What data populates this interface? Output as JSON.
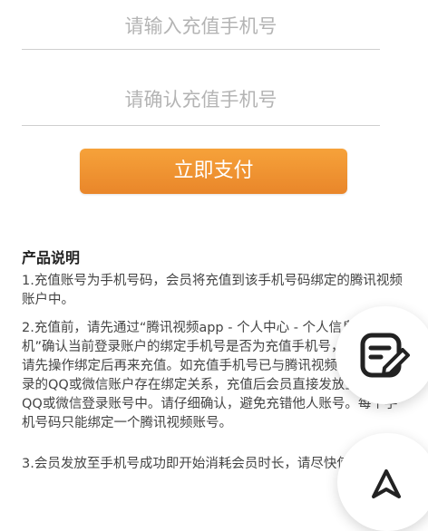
{
  "form": {
    "phone_placeholder": "请输入充值手机号",
    "confirm_placeholder": "请确认充值手机号",
    "pay_button": "立即支付"
  },
  "product": {
    "title": "产品说明",
    "paragraphs": [
      "1.充值账号为手机号码，会员将充值到该手机号码绑定的腾讯视频账户中。",
      "2.充值前，请先通过“腾讯视频app - 个人中心 - 个人信息 - 手机”确认当前登录账户的绑定手机号是否为充值手机号，若未绑定的请先操作绑定后再来充值。如充值手机号已与腾讯视频app中与登录的QQ或微信账户存在绑定关系，充值后会员直接发放至绑定的QQ或微信登录账号中。请仔细确认，避免充错他人账号。每个手机号码只能绑定一个腾讯视频账号。",
      "3.会员发放至手机号成功即开始消耗会员时长，请尽快使用。"
    ]
  },
  "floating": {
    "edit_icon": "edit-note-icon",
    "second_icon": "navigation-icon"
  }
}
